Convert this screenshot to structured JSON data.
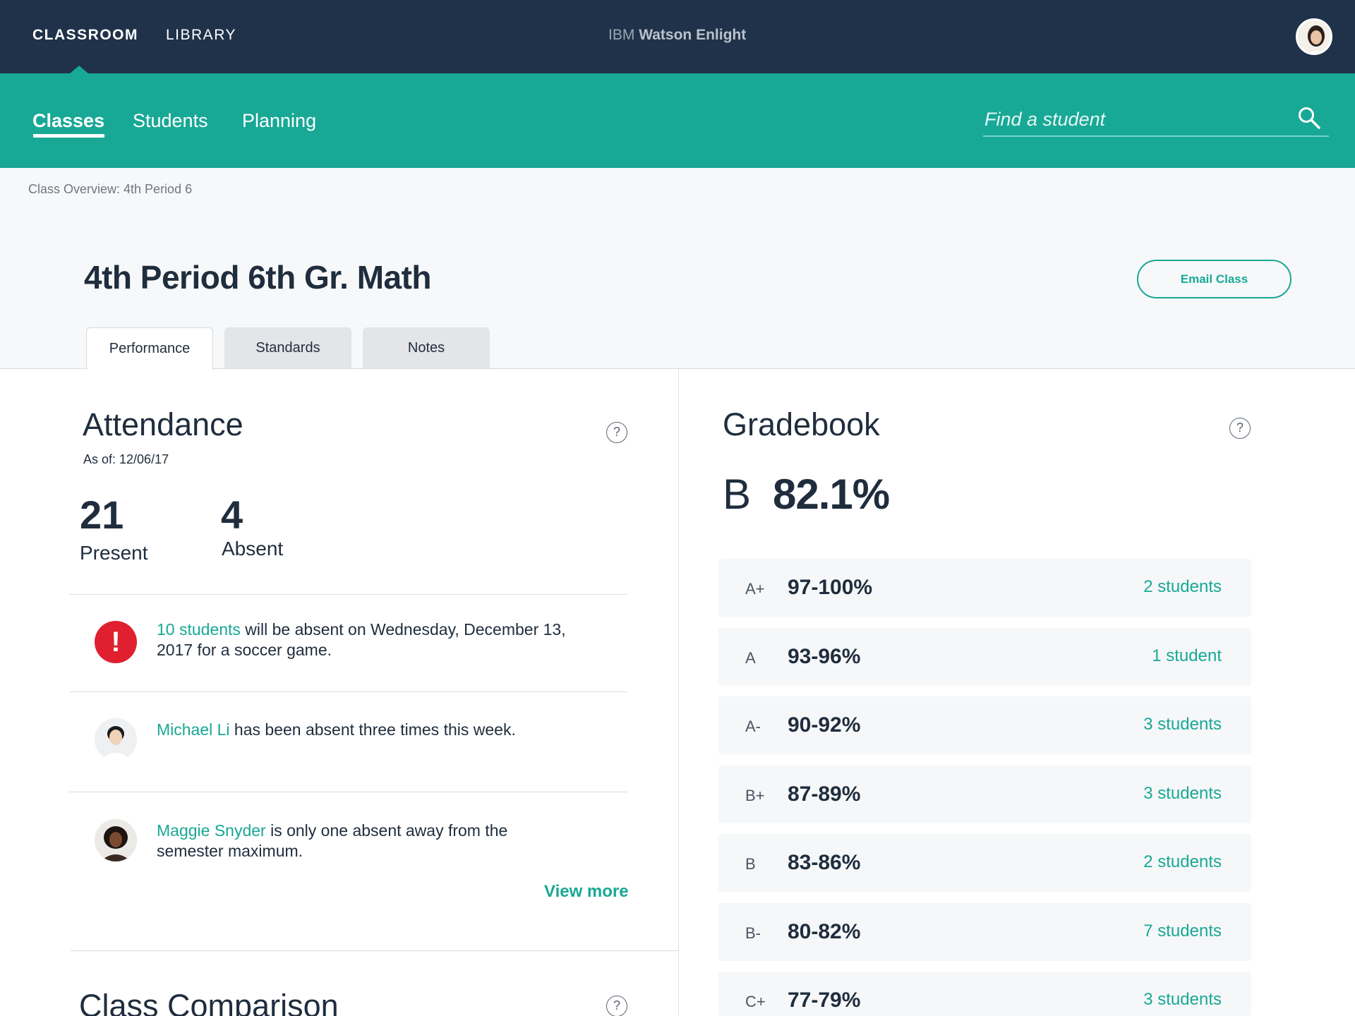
{
  "topbar": {
    "nav_classroom": "CLASSROOM",
    "nav_library": "LIBRARY",
    "brand_prefix": "IBM",
    "brand_name": "Watson Enlight"
  },
  "subnav": {
    "classes": "Classes",
    "students": "Students",
    "planning": "Planning",
    "search_placeholder": "Find a student"
  },
  "header": {
    "breadcrumb": "Class Overview: 4th Period 6",
    "title": "4th Period 6th Gr. Math",
    "email_button": "Email Class",
    "tabs": [
      {
        "label": "Performance",
        "active": true
      },
      {
        "label": "Standards",
        "active": false
      },
      {
        "label": "Notes",
        "active": false
      }
    ]
  },
  "attendance": {
    "title": "Attendance",
    "as_of": "As of: 12/06/17",
    "present_count": "21",
    "present_label": "Present",
    "absent_count": "4",
    "absent_label": "Absent",
    "notices": [
      {
        "link": "10 students",
        "text": " will be absent on Wednesday, December 13, 2017 for a soccer game."
      },
      {
        "link": "Michael Li",
        "text": " has been absent three times this week."
      },
      {
        "link": "Maggie Snyder",
        "text": " is only one absent away from the semester maximum."
      }
    ],
    "view_more": "View more",
    "help": "?"
  },
  "comparison": {
    "title": "Class Comparison",
    "help": "?"
  },
  "gradebook": {
    "title": "Gradebook",
    "help": "?",
    "overall_letter": "B",
    "overall_percent": "82.1%",
    "rows": [
      {
        "letter": "A+",
        "range": "97-100%",
        "count": "2 students"
      },
      {
        "letter": "A",
        "range": "93-96%",
        "count": "1 student"
      },
      {
        "letter": "A-",
        "range": "90-92%",
        "count": "3 students"
      },
      {
        "letter": "B+",
        "range": "87-89%",
        "count": "3 students"
      },
      {
        "letter": "B",
        "range": "83-86%",
        "count": "2 students"
      },
      {
        "letter": "B-",
        "range": "80-82%",
        "count": "7 students"
      },
      {
        "letter": "C+",
        "range": "77-79%",
        "count": "3 students"
      }
    ]
  },
  "colors": {
    "navy": "#1f3249",
    "teal": "#18a896",
    "alert_red": "#e0202f"
  },
  "icons": {
    "search": "search-icon",
    "alert": "alert-icon",
    "help": "help-icon"
  }
}
